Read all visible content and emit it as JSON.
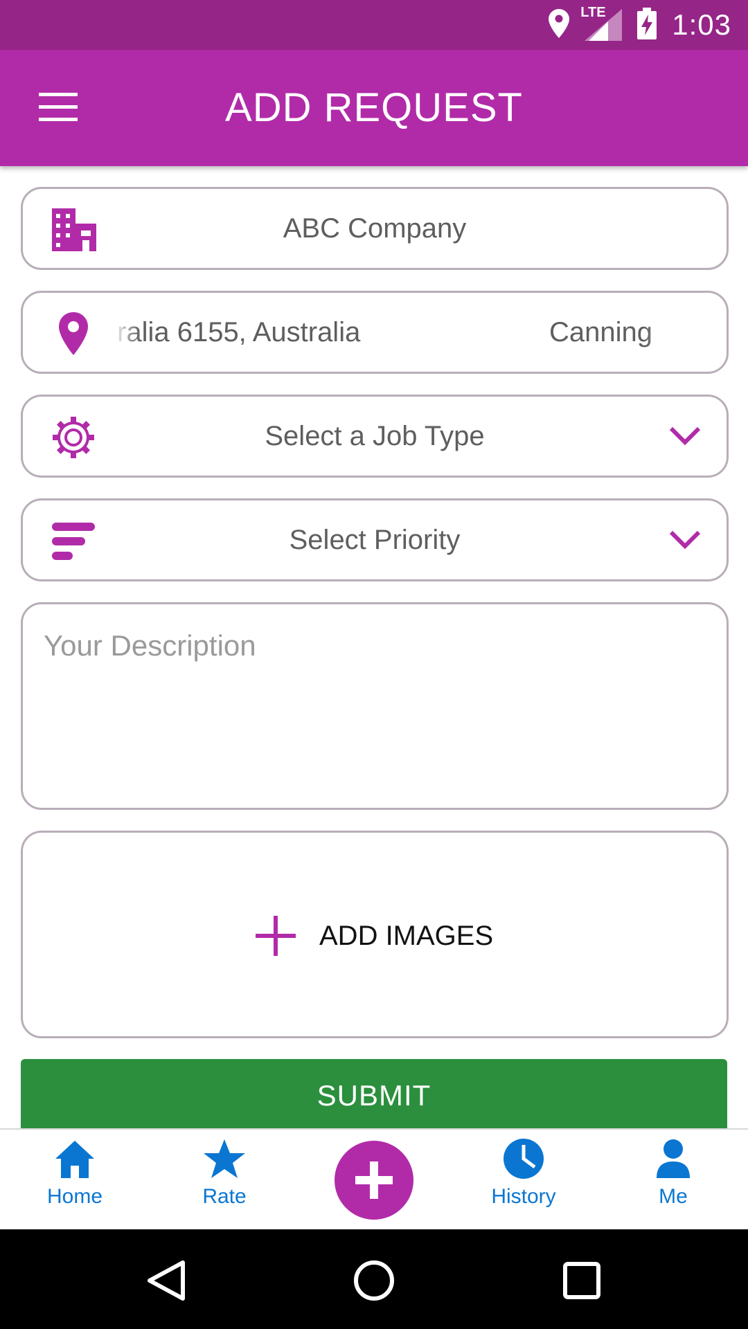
{
  "status_bar": {
    "time": "1:03",
    "network": "LTE",
    "icons": [
      "location-icon",
      "signal-icon",
      "battery-charging-icon"
    ]
  },
  "app_bar": {
    "title": "ADD REQUEST",
    "menu_icon": "hamburger-menu-icon"
  },
  "form": {
    "company": {
      "value": "ABC Company",
      "icon": "building-icon"
    },
    "address": {
      "left_text": "ralia 6155, Australia",
      "right_text": "Canning",
      "icon": "location-pin-icon"
    },
    "job_type": {
      "value": "Select a Job Type",
      "icon": "gear-icon"
    },
    "priority": {
      "value": "Select Priority",
      "icon": "priority-bars-icon"
    },
    "description": {
      "placeholder": "Your Description"
    },
    "add_images": {
      "label": "ADD IMAGES"
    },
    "submit_label": "SUBMIT"
  },
  "bottom_nav": {
    "items": [
      {
        "label": "Home",
        "icon": "home-icon"
      },
      {
        "label": "Rate",
        "icon": "star-icon"
      },
      {
        "label": "",
        "icon": "add-icon"
      },
      {
        "label": "History",
        "icon": "clock-icon"
      },
      {
        "label": "Me",
        "icon": "person-icon"
      }
    ]
  },
  "colors": {
    "status_bar": "#962588",
    "accent": "#b12ba8",
    "submit": "#2b8f3d",
    "nav_blue": "#0b76d1"
  }
}
